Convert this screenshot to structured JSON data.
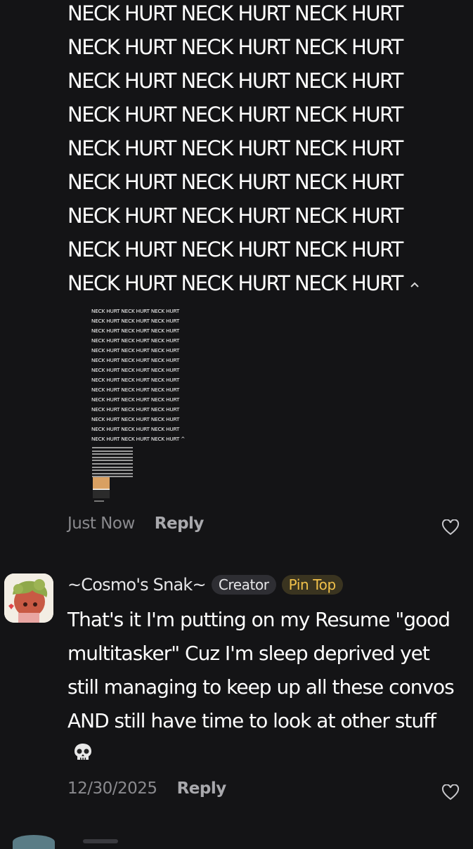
{
  "message": {
    "repeat_line": "NECK HURT NECK HURT NECK HURT",
    "line_count": 9,
    "collapse_icon": "chevron-up-icon"
  },
  "attachment": {
    "repeat_line": "NECK HURT NECK HURT NECK HURT",
    "line_count": 14,
    "last_suffix": "^"
  },
  "reply1": {
    "time": "Just Now",
    "reply_label": "Reply",
    "like_icon": "heart-outline-icon"
  },
  "comment": {
    "author": "~Cosmo's Snak~",
    "badge_creator": "Creator",
    "badge_pin": "Pin Top",
    "text": "That's it I'm putting on my Resume \"good multitasker\" Cuz I'm sleep deprived yet still managing to keep up all these convos AND still have time to look at other stuff",
    "emoji_icon": "skull-icon",
    "time": "12/30/2025",
    "reply_label": "Reply",
    "like_icon": "heart-outline-icon",
    "colors": {
      "pin_text": "#f1c14a",
      "pin_bg": "#3a3420",
      "creator_bg": "#2e2e33"
    }
  }
}
